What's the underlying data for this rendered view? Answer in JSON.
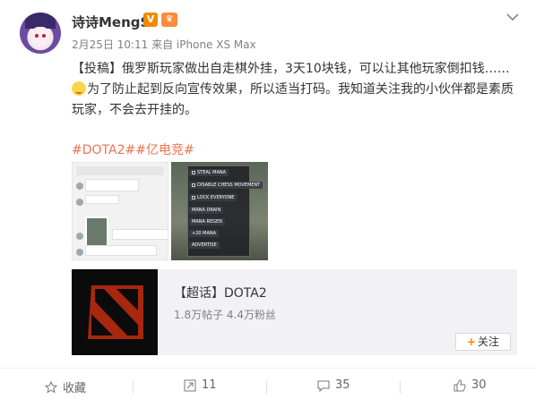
{
  "user": {
    "name": "诗诗MengS",
    "verified_badge": "V",
    "level_badge": "♛",
    "meta": "2月25日 10:11 来自 iPhone XS Max"
  },
  "post": {
    "line1": "【投稿】俄罗斯玩家做出自走棋外挂，3天10块钱，可以让其他玩家倒扣钱……",
    "line2": "为了防止起到反向宣传效果，所以适当打码。我知道关注我的小伙伴都是素质",
    "line3": "玩家，不会去开挂的。",
    "tags": "#DOTA2##亿电竞#"
  },
  "image2_options": [
    "STEAL MANA",
    "DISABLE CHESS MOVEMENT",
    "LOCK EVERYONE",
    "MANA DRAIN",
    "MANA REGEN",
    "+20 MANA",
    "ADVERTISE"
  ],
  "card": {
    "title": "【超话】DOTA2",
    "stats": "1.8万帖子 4.4万粉丝",
    "follow_label": "关注"
  },
  "actions": {
    "favorite": "收藏",
    "repost": "11",
    "comment": "35",
    "like": "30"
  },
  "colors": {
    "tag": "#eb7350",
    "follow_plus": "#ff8200",
    "badge": "#f08a00"
  }
}
